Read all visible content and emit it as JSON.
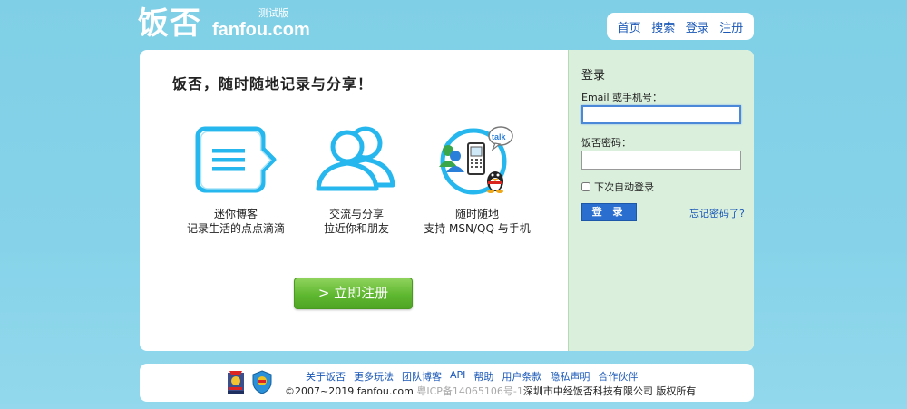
{
  "logo": {
    "cn": "饭否",
    "en": "fanfou.com",
    "beta": "测试版"
  },
  "nav": [
    {
      "label": "首页"
    },
    {
      "label": "搜索"
    },
    {
      "label": "登录"
    },
    {
      "label": "注册"
    }
  ],
  "main": {
    "slogan": "饭否，随时随地记录与分享！",
    "features": [
      {
        "icon": "speech-bubble-icon",
        "line1": "迷你博客",
        "line2": "记录生活的点点滴滴"
      },
      {
        "icon": "people-icon",
        "line1": "交流与分享",
        "line2": "拉近你和朋友"
      },
      {
        "icon": "im-devices-icon",
        "line1": "随时随地",
        "line2": "支持 MSN/QQ 与手机"
      }
    ],
    "signup_button": "> 立即注册"
  },
  "login": {
    "title": "登录",
    "email_label": "Email 或手机号：",
    "email_value": "",
    "password_label": "饭否密码：",
    "password_value": "",
    "remember_label": "下次自动登录",
    "remember_checked": false,
    "submit_label": "登 录",
    "forgot_label": "忘记密码了?"
  },
  "footer": {
    "links": [
      "关于饭否",
      "更多玩法",
      "团队博客",
      "API",
      "帮助",
      "用户条款",
      "隐私声明",
      "合作伙伴"
    ],
    "copyright": "©2007~2019 fanfou.com",
    "icp": "粤ICP备14065106号-1",
    "company": "深圳市中经饭否科技有限公司 版权所有"
  },
  "colors": {
    "background": "#86d3e9",
    "link": "#1a58b8",
    "login_panel": "#dbf0dc",
    "signup_green": "#5fb830",
    "login_blue": "#2a6fd0",
    "icon_cyan": "#26b7ee"
  }
}
